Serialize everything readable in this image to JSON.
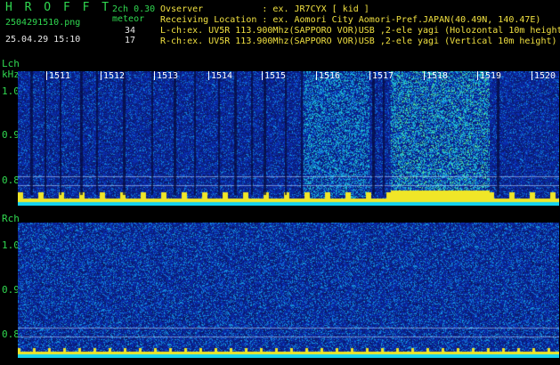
{
  "header": {
    "brand": "H R O F F T",
    "filename": "2504291510.png",
    "datetime": "25.04.29 15:10",
    "channels": "2ch 0.30",
    "meteor_label": "meteor",
    "count_l": "34",
    "count_r": "17",
    "observer_line": "Ovserver           : ex. JR7CYX [ kid ]",
    "location_line": "Receiving Location : ex. Aomori City Aomori-Pref.JAPAN(40.49N, 140.47E)",
    "lch_line": "L-ch:ex. UV5R 113.900Mhz(SAPPORO VOR)USB ,2-ele yagi (Holozontal 10m height)",
    "rch_line": "R-ch:ex. UV5R 113.900Mhz(SAPPORO VOR)USB ,2-ele yagi (Vertical 10m height)"
  },
  "lch_panel": {
    "label": "Lch",
    "unit": "kHz",
    "ticks": [
      "1.0",
      "0.9",
      "0.8"
    ],
    "minute_marks": [
      "1511",
      "1512",
      "1513",
      "1514",
      "1515",
      "1516",
      "1517",
      "1518",
      "1519",
      "1520"
    ]
  },
  "rch_panel": {
    "label": "Rch",
    "ticks": [
      "1.0",
      "0.9",
      "0.8"
    ]
  },
  "colors": {
    "background": "#000000",
    "label_green": "#30d850",
    "text_white": "#e8e8e8",
    "meteor_yellow": "#f0e040",
    "noise_deep_blue": "#0a1e8c",
    "noise_cyan": "#18d8f0"
  }
}
